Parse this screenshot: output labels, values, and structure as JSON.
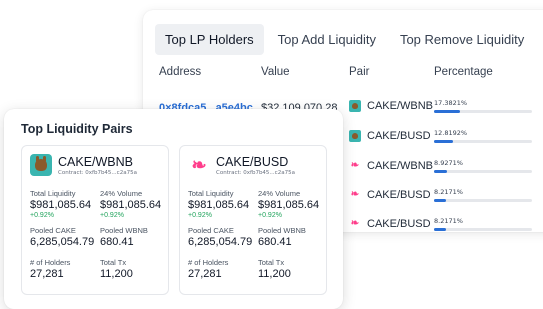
{
  "lp_table": {
    "tabs": [
      "Top LP Holders",
      "Top Add Liquidity",
      "Top Remove Liquidity"
    ],
    "active_tab": 0,
    "columns": {
      "address": "Address",
      "value": "Value",
      "pair": "Pair",
      "percentage": "Percentage"
    },
    "rows": [
      {
        "address": "0×8fdca5...a5e4bc",
        "value": "$32,109,070.28",
        "pair": "CAKE/WBNB",
        "icon": "pancakeswap-icon",
        "percentage": "17.3821%",
        "fill": 0.174
      },
      {
        "address": "",
        "value": "",
        "pair": "CAKE/BUSD",
        "icon": "pancakeswap-icon",
        "percentage": "12.8192%",
        "fill": 0.128
      },
      {
        "address": "",
        "value": "",
        "pair": "CAKE/WBNB",
        "icon": "uniswap-icon",
        "percentage": "8.9271%",
        "fill": 0.089
      },
      {
        "address": "",
        "value": "",
        "pair": "CAKE/BUSD",
        "icon": "uniswap-icon",
        "percentage": "8.2171%",
        "fill": 0.082
      },
      {
        "address": "",
        "value": "",
        "pair": "CAKE/BUSD",
        "icon": "uniswap-icon",
        "percentage": "8.2171%",
        "fill": 0.082
      }
    ]
  },
  "pairs_panel": {
    "title": "Top Liquidity Pairs",
    "cards": [
      {
        "name": "CAKE/WBNB",
        "contract": "Contract: 0xfb7b45...c2a75a",
        "icon": "pancakeswap-icon",
        "total_liquidity_label": "Total Liquidity",
        "total_liquidity": "$981,085.64",
        "total_liquidity_change": "+0.92%",
        "volume_label": "24% Volume",
        "volume": "$981,085.64",
        "volume_change": "+0.92%",
        "pooled_a_label": "Pooled CAKE",
        "pooled_a": "6,285,054.79",
        "pooled_b_label": "Pooled WBNB",
        "pooled_b": "680.41",
        "holders_label": "# of Holders",
        "holders": "27,281",
        "tx_label": "Total Tx",
        "tx": "11,200"
      },
      {
        "name": "CAKE/BUSD",
        "contract": "Contract: 0xfb7b45...c2a75a",
        "icon": "uniswap-icon",
        "total_liquidity_label": "Total Liquidity",
        "total_liquidity": "$981,085.64",
        "total_liquidity_change": "+0.92%",
        "volume_label": "24% Volume",
        "volume": "$981,085.64",
        "volume_change": "+0.92%",
        "pooled_a_label": "Pooled CAKE",
        "pooled_a": "6,285,054.79",
        "pooled_b_label": "Pooled WBNB",
        "pooled_b": "680.41",
        "holders_label": "# of Holders",
        "holders": "27,281",
        "tx_label": "Total Tx",
        "tx": "11,200"
      }
    ]
  }
}
